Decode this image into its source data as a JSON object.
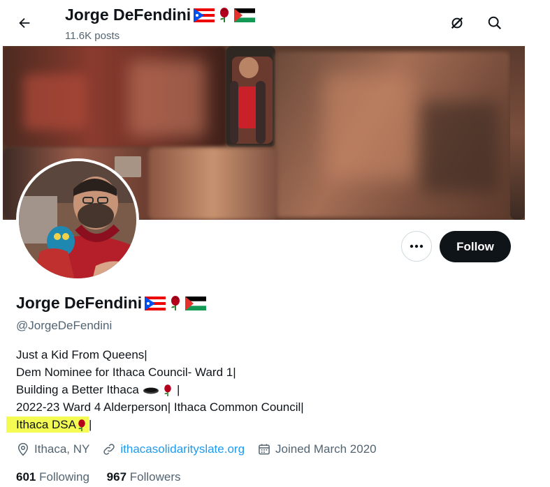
{
  "header": {
    "name": "Jorge DeFendini",
    "posts": "11.6K posts"
  },
  "profile": {
    "display_name": "Jorge DeFendini",
    "handle": "@JorgeDeFendini",
    "name_emojis": [
      "puerto-rico-flag",
      "rose",
      "palestine-flag"
    ]
  },
  "actions": {
    "follow_label": "Follow"
  },
  "bio": {
    "line1": "Just a Kid From Queens|",
    "line2": "Dem Nominee for Ithaca Council- Ward 1|",
    "line3_text": "Building a Better Ithaca ",
    "line3_end": " |",
    "line4": "2022-23 Ward 4 Alderperson| Ithaca Common Council|",
    "line5_text": "Ithaca DSA",
    "line5_end": "|"
  },
  "meta": {
    "location": "Ithaca, NY",
    "website": "ithacasolidarityslate.org",
    "joined": "Joined March 2020"
  },
  "stats": {
    "following_count": "601",
    "following_label": "Following",
    "followers_count": "967",
    "followers_label": "Followers"
  },
  "colors": {
    "accent_link": "#1d9bf0",
    "follow_bg": "#0f1419",
    "muted_text": "#536471",
    "highlight": "#f4fb52"
  }
}
